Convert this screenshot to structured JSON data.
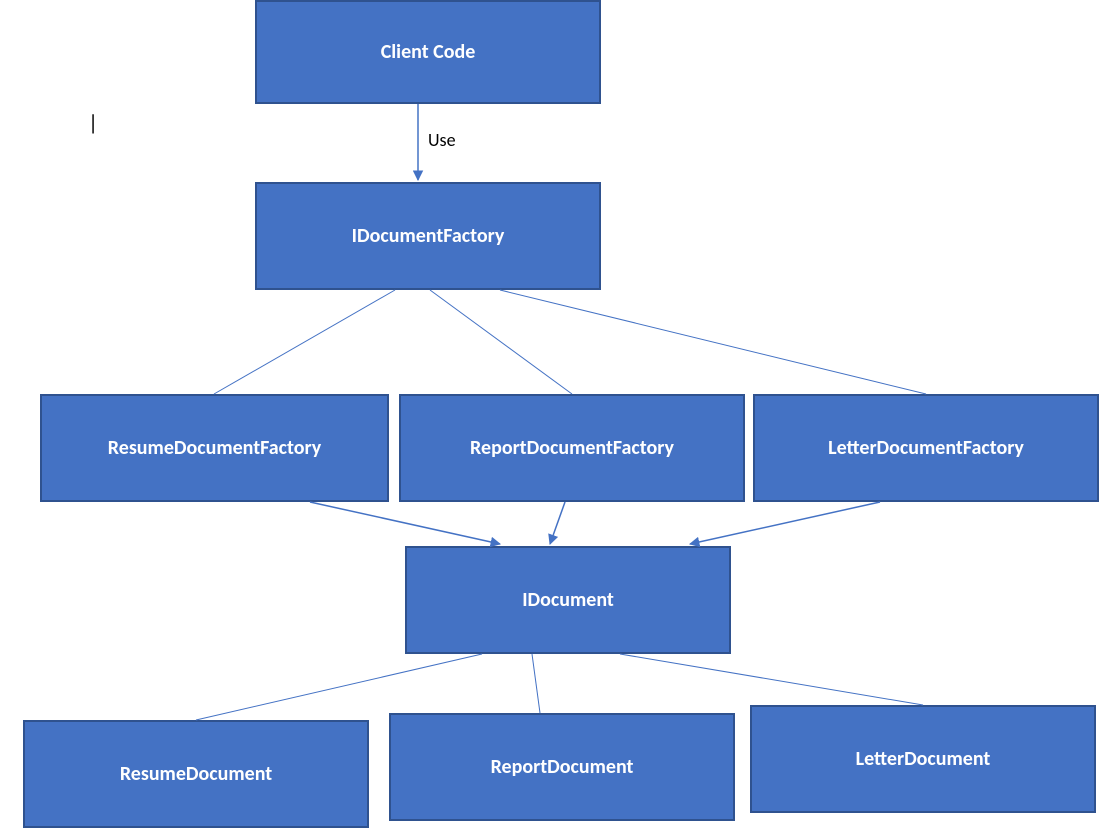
{
  "nodes": {
    "client_code": "Client Code",
    "idocument_factory": "IDocumentFactory",
    "resume_doc_factory": "ResumeDocumentFactory",
    "report_doc_factory": "ReportDocumentFactory",
    "letter_doc_factory": "LetterDocumentFactory",
    "idocument": "IDocument",
    "resume_document": "ResumeDocument",
    "report_document": "ReportDocument",
    "letter_document": "LetterDocument"
  },
  "edge_labels": {
    "use": "Use"
  },
  "cursor_mark": "|",
  "colors": {
    "box_fill": "#4472c4",
    "box_border": "#2f528f",
    "line": "#4472c4"
  }
}
